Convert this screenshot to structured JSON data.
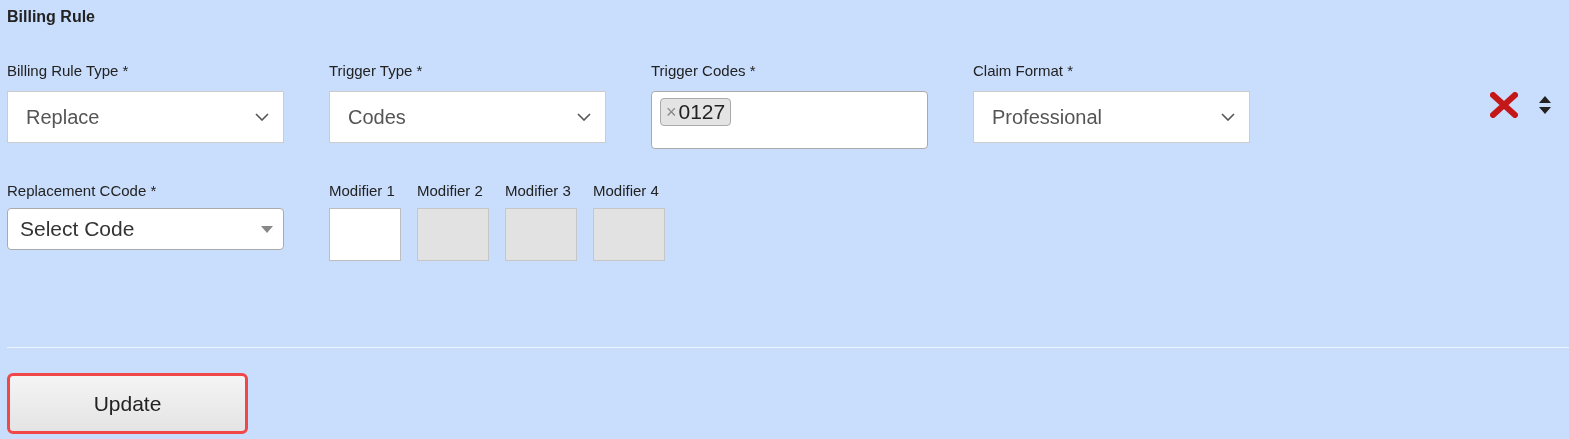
{
  "section": {
    "title": "Billing Rule"
  },
  "fields": [
    {
      "kind": "select",
      "label": "Billing Rule Type *",
      "value": "Replace"
    },
    {
      "kind": "select",
      "label": "Trigger Type *",
      "value": "Codes"
    },
    {
      "kind": "tags",
      "label": "Trigger Codes *",
      "tags": [
        {
          "remove": "×",
          "text": "0127"
        }
      ]
    },
    {
      "kind": "select",
      "label": "Claim Format *",
      "value": "Professional"
    }
  ],
  "replacement": {
    "label": "Replacement CCode *",
    "placeholder": "Select Code"
  },
  "modifiers": [
    {
      "label": "Modifier 1",
      "disabled": false
    },
    {
      "label": "Modifier 2",
      "disabled": true
    },
    {
      "label": "Modifier 3",
      "disabled": true
    },
    {
      "label": "Modifier 4",
      "disabled": true
    }
  ],
  "button": {
    "label": "Update",
    "focused": true
  }
}
